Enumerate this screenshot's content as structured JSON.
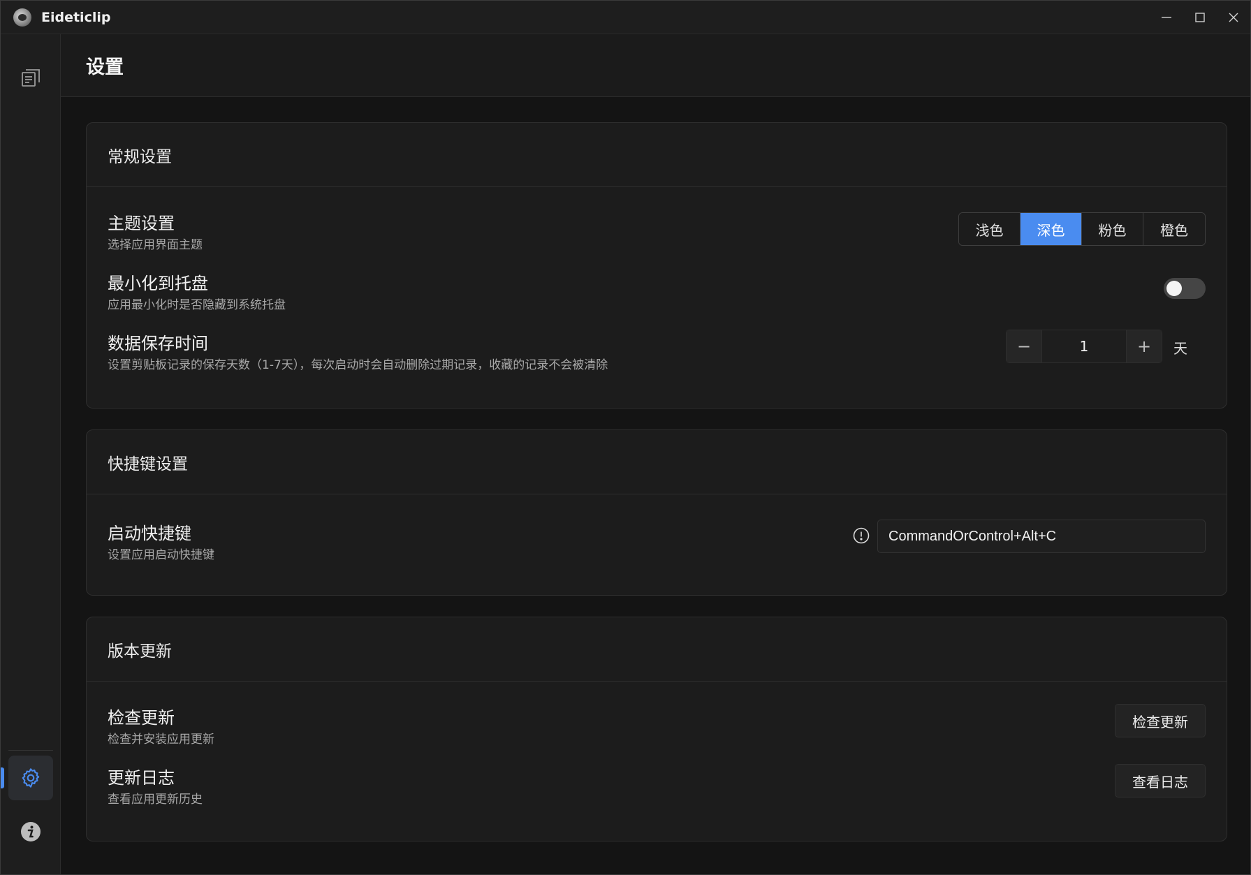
{
  "app": {
    "title": "Eideticlip"
  },
  "window_controls": {
    "minimize": "minimize-icon",
    "maximize": "maximize-icon",
    "close": "close-icon"
  },
  "sidebar": {
    "items": [
      {
        "name": "clipboard-history",
        "icon": "clipboard-list-icon",
        "active": false
      },
      {
        "name": "settings",
        "icon": "gear-icon",
        "active": true
      },
      {
        "name": "about",
        "icon": "info-icon",
        "active": false
      }
    ],
    "accent": "#4a8cf0"
  },
  "page": {
    "title": "设置"
  },
  "general": {
    "title": "常规设置",
    "theme": {
      "title": "主题设置",
      "desc": "选择应用界面主题",
      "options": [
        "浅色",
        "深色",
        "粉色",
        "橙色"
      ],
      "selected": "深色"
    },
    "tray": {
      "title": "最小化到托盘",
      "desc": "应用最小化时是否隐藏到系统托盘",
      "enabled": false
    },
    "retention": {
      "title": "数据保存时间",
      "desc": "设置剪贴板记录的保存天数（1-7天），每次启动时会自动删除过期记录，收藏的记录不会被清除",
      "value": "1",
      "minus": "−",
      "plus": "+",
      "unit": "天"
    }
  },
  "shortcuts": {
    "title": "快捷键设置",
    "launch": {
      "title": "启动快捷键",
      "desc": "设置应用启动快捷键",
      "value": "CommandOrControl+Alt+C"
    }
  },
  "updates": {
    "title": "版本更新",
    "check": {
      "title": "检查更新",
      "desc": "检查并安装应用更新",
      "button": "检查更新"
    },
    "log": {
      "title": "更新日志",
      "desc": "查看应用更新历史",
      "button": "查看日志"
    }
  }
}
